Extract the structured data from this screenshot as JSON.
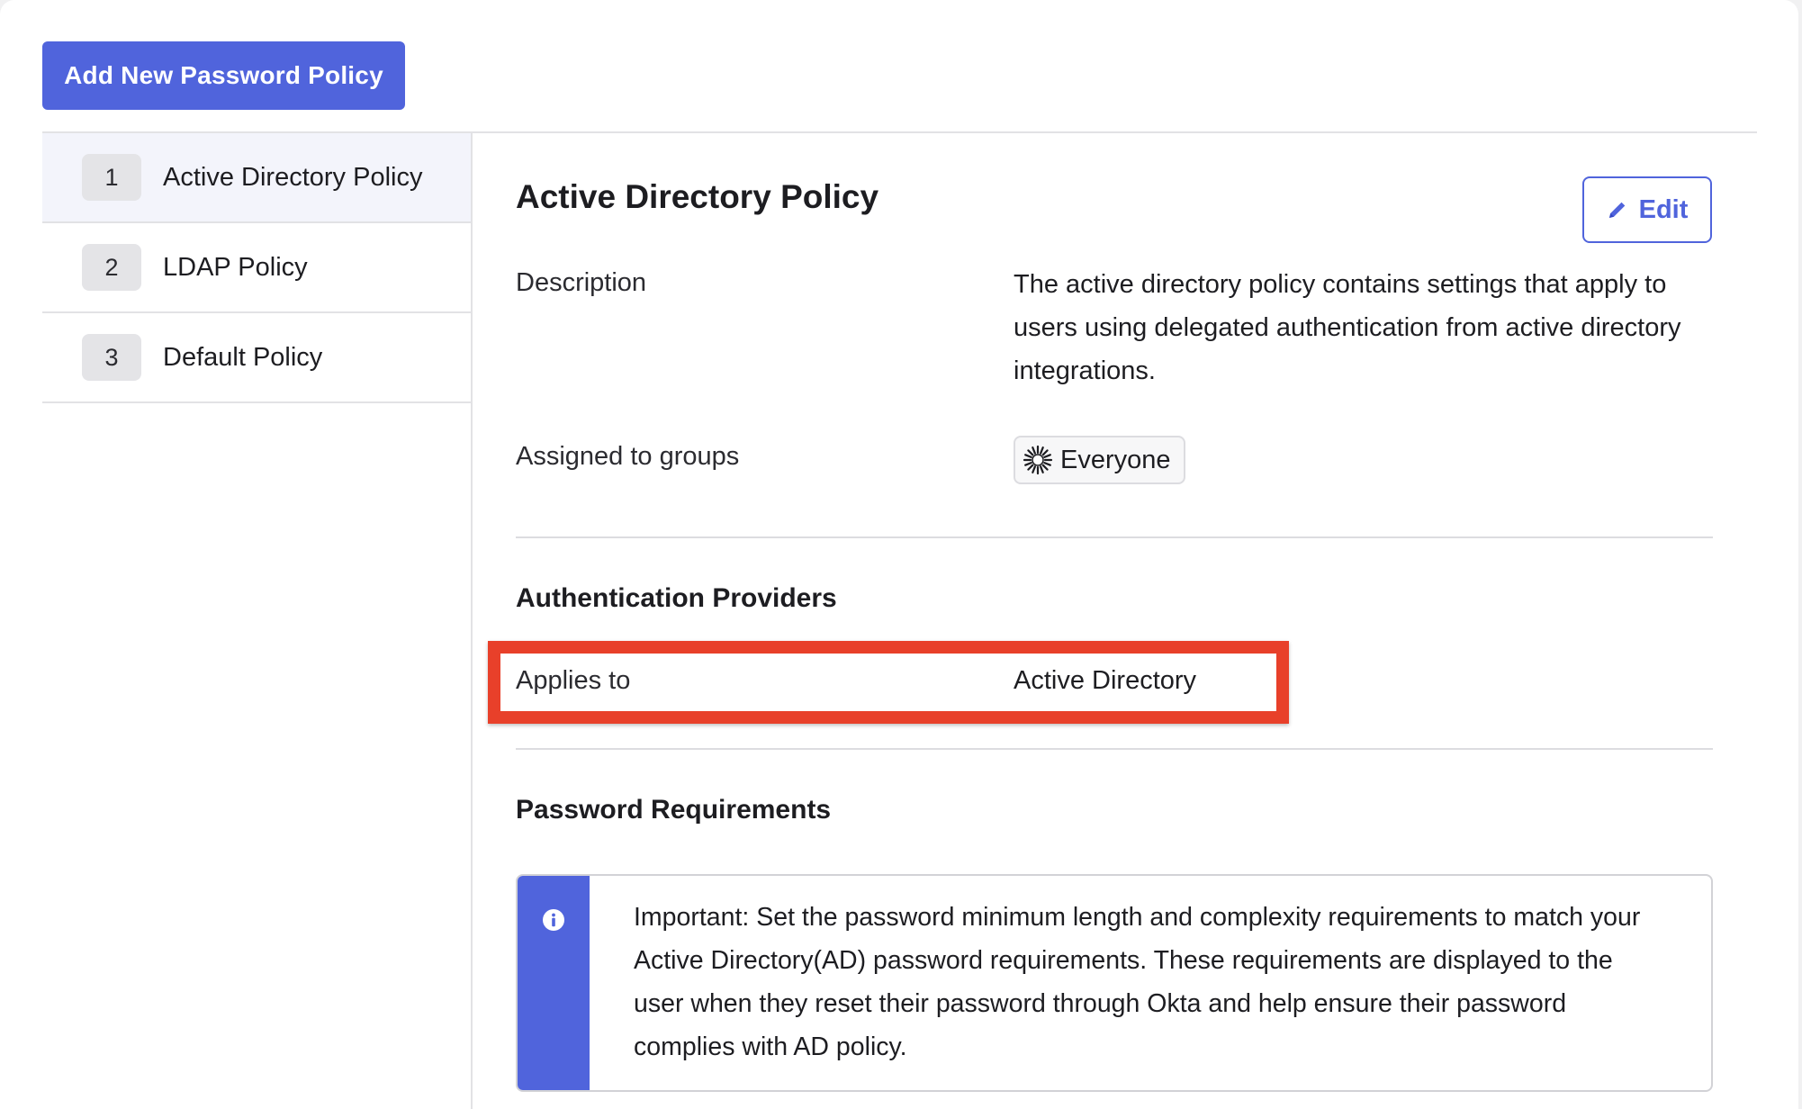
{
  "toolbar": {
    "add_label": "Add New Password Policy"
  },
  "sidebar": {
    "items": [
      {
        "number": "1",
        "label": "Active Directory Policy"
      },
      {
        "number": "2",
        "label": "LDAP Policy"
      },
      {
        "number": "3",
        "label": "Default Policy"
      }
    ]
  },
  "detail": {
    "title": "Active Directory Policy",
    "edit_label": "Edit",
    "description_label": "Description",
    "description_value": "The active directory policy contains settings that apply to users using delegated authentication from active directory integrations.",
    "groups_label": "Assigned to groups",
    "group_chip": "Everyone"
  },
  "auth_providers": {
    "title": "Authentication Providers",
    "applies_label": "Applies to",
    "applies_value": "Active Directory"
  },
  "password_requirements": {
    "title": "Password Requirements",
    "callout_text": "Important: Set the password minimum length and complexity requirements to match your Active Directory(AD) password requirements. These requirements are displayed to the user when they reset their password through Okta and help ensure their password complies with AD policy."
  },
  "colors": {
    "accent": "#5064dc",
    "highlight": "#e8402a"
  },
  "icons": {
    "edit": "pencil-icon",
    "group": "sunburst-group-icon",
    "info": "info-icon"
  }
}
